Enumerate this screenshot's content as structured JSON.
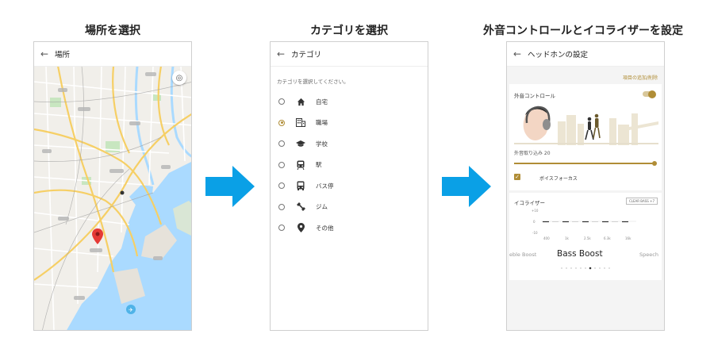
{
  "steps": [
    {
      "title": "場所を選択"
    },
    {
      "title": "カテゴリを選択"
    },
    {
      "title": "外音コントロールとイコライザーを設定"
    }
  ],
  "screen1": {
    "header": "場所",
    "back_icon": "arrow-left-icon",
    "locate_icon": "my-location-icon"
  },
  "screen2": {
    "header": "カテゴリ",
    "prompt": "カテゴリを選択してください。",
    "options": [
      {
        "label": "自宅",
        "icon": "home-icon",
        "selected": false
      },
      {
        "label": "職場",
        "icon": "office-building-icon",
        "selected": true
      },
      {
        "label": "学校",
        "icon": "school-cap-icon",
        "selected": false
      },
      {
        "label": "駅",
        "icon": "train-icon",
        "selected": false
      },
      {
        "label": "バス停",
        "icon": "bus-icon",
        "selected": false
      },
      {
        "label": "ジム",
        "icon": "gym-icon",
        "selected": false
      },
      {
        "label": "その他",
        "icon": "place-pin-icon",
        "selected": false
      }
    ]
  },
  "screen3": {
    "header": "ヘッドホンの設定",
    "add_remove_link": "項目の追加/削除",
    "ambient": {
      "title": "外音コントロール",
      "level_label": "外音取り込み 20",
      "toggle_on": true,
      "level": 20
    },
    "voice_focus": {
      "label": "ボイスフォーカス",
      "checked": true
    },
    "equalizer": {
      "title": "イコライザー",
      "clear_bass_label": "CLEAR BASS +7",
      "y_ticks": [
        "+10",
        "0",
        "-10"
      ],
      "x_ticks": [
        "400",
        "1k",
        "2.5k",
        "6.3k",
        "16k"
      ],
      "presets_prev": "eble Boost",
      "preset_current": "Bass Boost",
      "presets_next": "Speech"
    }
  },
  "colors": {
    "accent": "#b08d36",
    "arrow": "#0aa0e6",
    "water": "#aadaff",
    "land": "#f1efea"
  }
}
